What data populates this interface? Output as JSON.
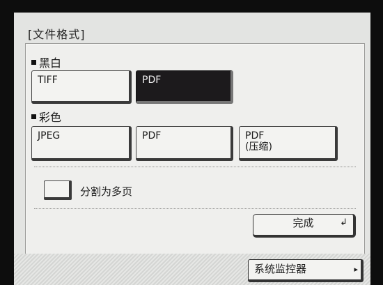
{
  "screen": {
    "title": "[文件格式]"
  },
  "monochrome": {
    "label": "黑白",
    "options": [
      {
        "label": "TIFF",
        "selected": false
      },
      {
        "label": "PDF",
        "selected": true
      }
    ]
  },
  "color": {
    "label": "彩色",
    "options": [
      {
        "label": "JPEG",
        "selected": false
      },
      {
        "label": "PDF",
        "selected": false
      },
      {
        "label_line1": "PDF",
        "label_line2": "(压缩)",
        "selected": false
      }
    ]
  },
  "split_pages": {
    "label": "分割为多页",
    "checked": false
  },
  "actions": {
    "done_label": "完成",
    "done_icon": "enter-icon"
  },
  "footer": {
    "monitor_label": "系统监控器",
    "monitor_icon": "arrow-right-icon"
  },
  "colors": {
    "screen_bg": "#e3e4e2",
    "selected_bg": "#1c1a1c",
    "bezel": "#0d0d0d"
  }
}
